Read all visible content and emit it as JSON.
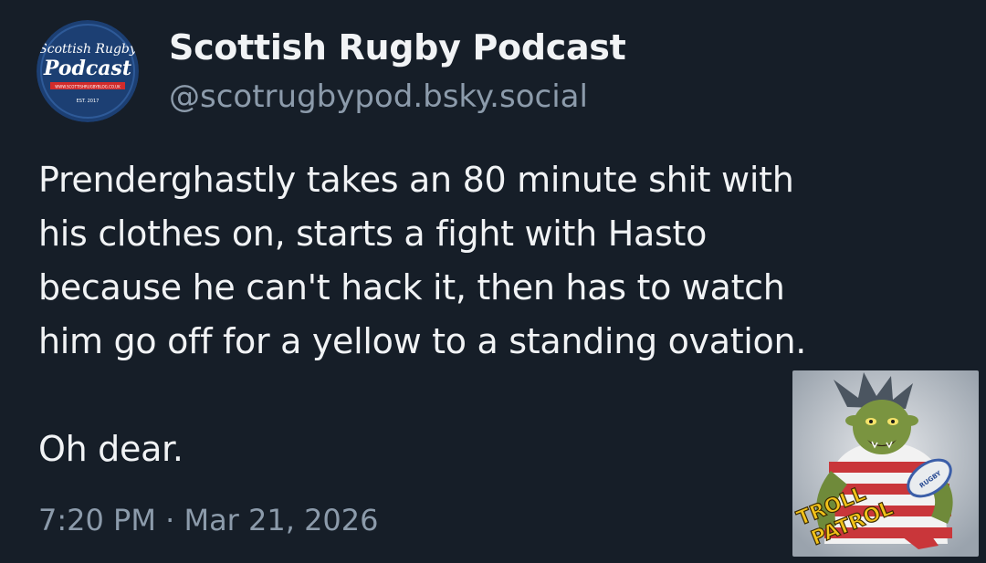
{
  "author": {
    "display_name": "Scottish Rugby Podcast",
    "handle": "@scotrugbypod.bsky.social",
    "avatar": {
      "line1": "Scottish Rugby",
      "line2": "Podcast",
      "website": "WWW.SCOTTISHRUGBYBLOG.CO.UK",
      "est": "EST. 2017"
    }
  },
  "post": {
    "lines": [
      "Prenderghastly takes an 80 minute shit with",
      "his clothes on, starts a fight with Hasto",
      "because he can't hack it, then has to watch",
      "him go off for a yellow to a standing ovation."
    ],
    "closing": "Oh dear.",
    "timestamp": "7:20 PM · Mar 21, 2026"
  },
  "sticker": {
    "line1": "TROLL",
    "line2": "PATROL",
    "ball_text": "RUGBY"
  },
  "colors": {
    "background": "#161e28",
    "text": "#f1f3f5",
    "muted": "#8c9bab",
    "avatar_bg": "#1c3f73",
    "sticker_text": "#f2c21a"
  }
}
